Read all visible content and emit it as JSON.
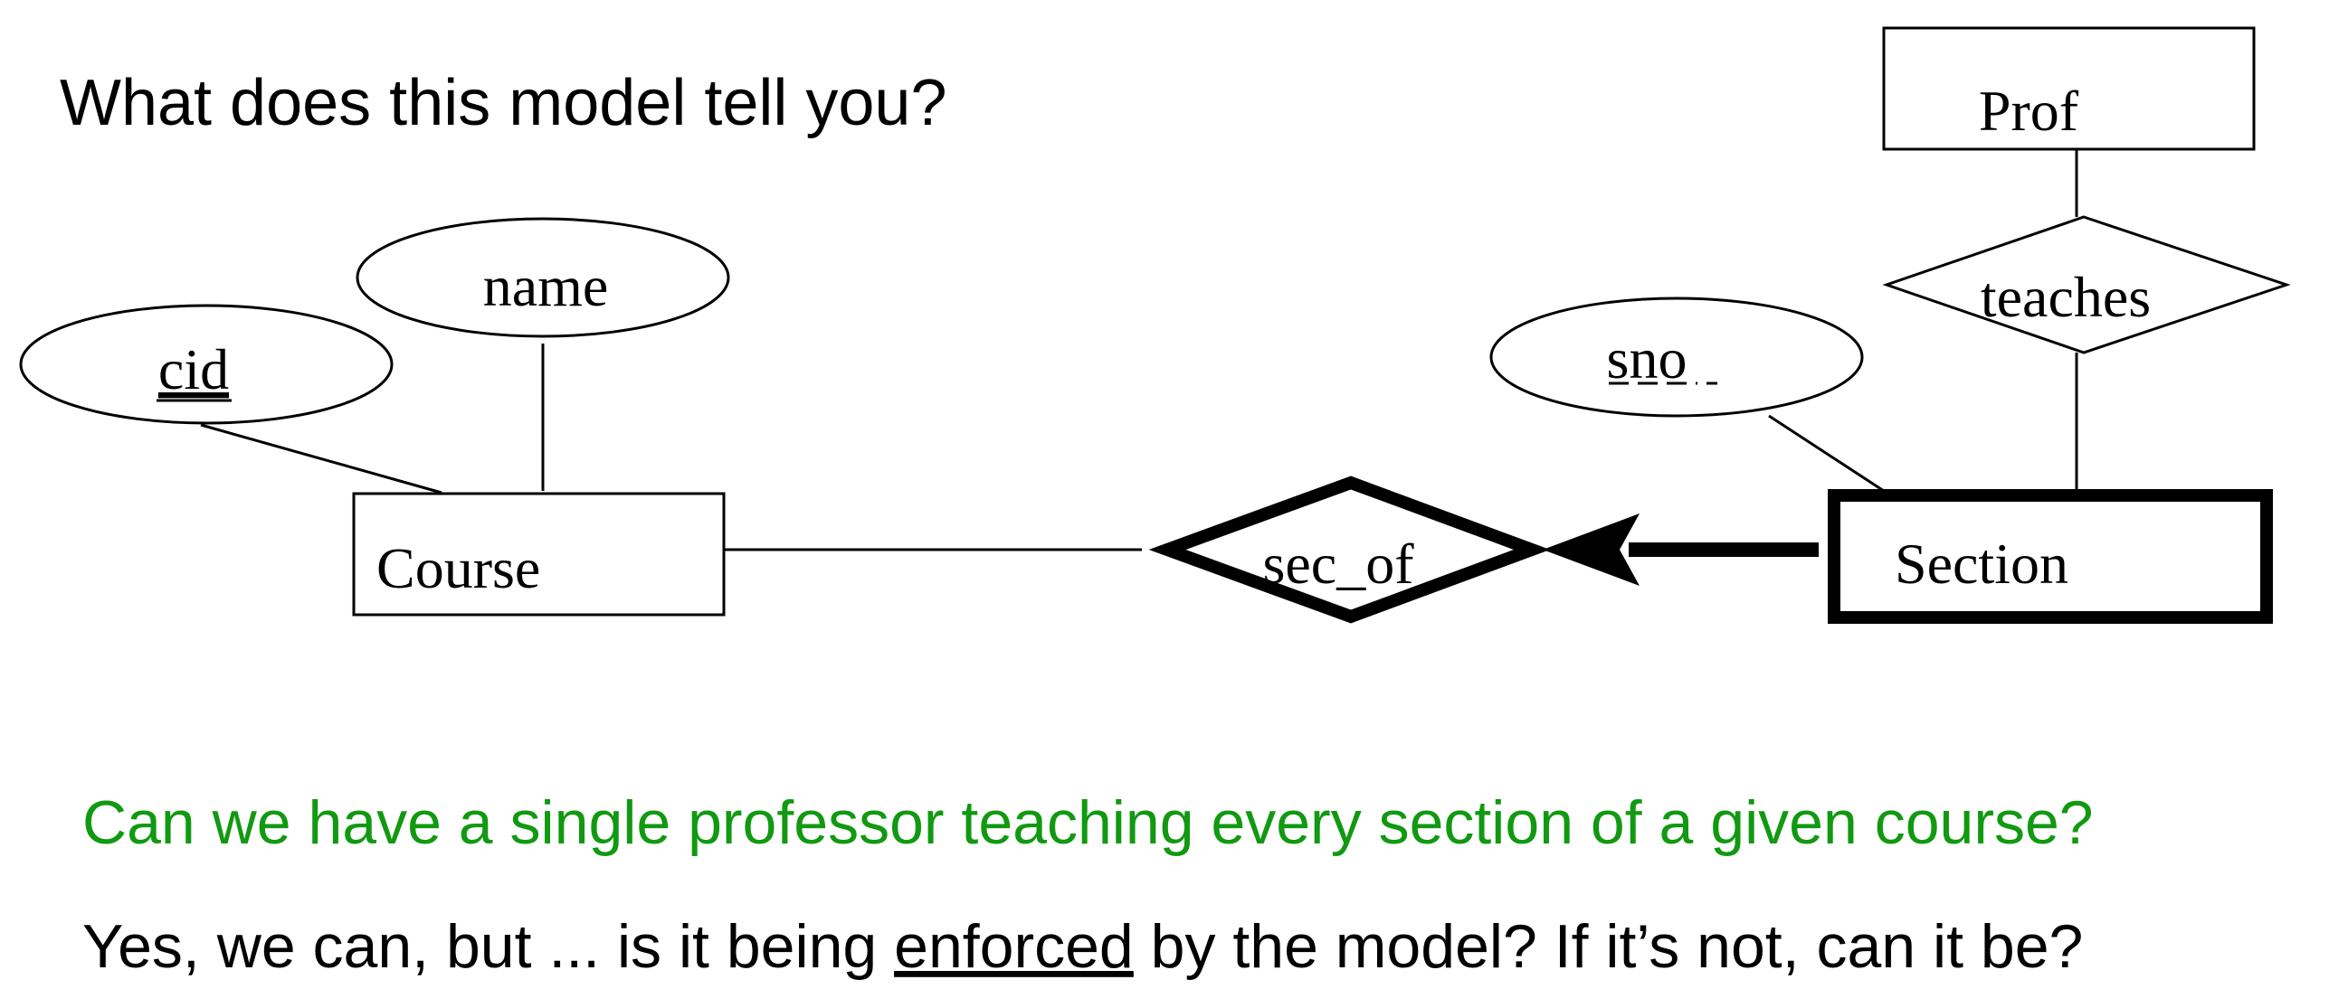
{
  "slide": {
    "heading": "What does this model tell you?",
    "question": "Can we have a single professor teaching every section of a given course?",
    "answer": {
      "before": "Yes, we can, but ... is it being ",
      "emphasis": "enforced",
      "after": " by the model? If it’s not, can it be?"
    }
  },
  "diagram": {
    "entities": {
      "course": "Course",
      "section": "Section",
      "prof": "Prof"
    },
    "relationships": {
      "sec_of": "sec_of",
      "teaches": "teaches"
    },
    "attributes": {
      "cid": "cid",
      "name": "name",
      "sno": "sno"
    }
  },
  "colors": {
    "question": "#119911",
    "text": "#000000"
  }
}
